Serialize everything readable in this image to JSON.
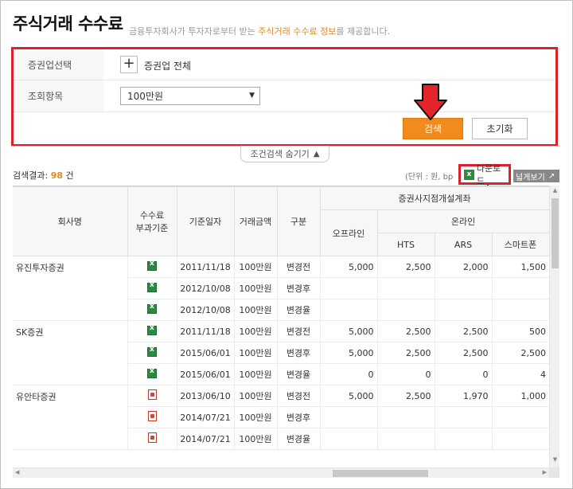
{
  "page": {
    "title": "주식거래 수수료",
    "subtitle_pre": "금융투자회사가 투자자로부터 받는 ",
    "subtitle_hl": "주식거래 수수료 정보",
    "subtitle_post": "를 제공합니다."
  },
  "search": {
    "company_label": "증권업선택",
    "company_plus": "+",
    "company_value": "증권업 전체",
    "item_label": "조회항목",
    "item_value": "100만원",
    "search_button": "검색",
    "reset_button": "초기화",
    "hide_toggle": "조건검색 숨기기"
  },
  "results": {
    "count_label": "검색결과: ",
    "count": "98",
    "count_unit": " 건",
    "unit_text": "(단위 : 원, bp",
    "download": "다운로드",
    "wide_view": "넓게보기"
  },
  "table": {
    "headers": {
      "company": "회사명",
      "basis_line1": "수수료",
      "basis_line2": "부과기준",
      "date": "기준일자",
      "amount": "거래금액",
      "type": "구분",
      "group": "증권사지점개설계좌",
      "offline": "오프라인",
      "online": "온라인",
      "hts": "HTS",
      "ars": "ARS",
      "smartphone": "스마트폰"
    },
    "rows": [
      {
        "company": "유진투자증권",
        "icon": "excel",
        "date": "2011/11/18",
        "amount": "100만원",
        "type": "변경전",
        "offline": "5,000",
        "hts": "2,500",
        "ars": "2,000",
        "smart": "1,500"
      },
      {
        "company": "",
        "icon": "excel",
        "date": "2012/10/08",
        "amount": "100만원",
        "type": "변경후",
        "offline": "",
        "hts": "",
        "ars": "",
        "smart": ""
      },
      {
        "company": "",
        "icon": "excel",
        "date": "2012/10/08",
        "amount": "100만원",
        "type": "변경율",
        "offline": "",
        "hts": "",
        "ars": "",
        "smart": ""
      },
      {
        "company": "SK증권",
        "icon": "excel",
        "date": "2011/11/18",
        "amount": "100만원",
        "type": "변경전",
        "offline": "5,000",
        "hts": "2,500",
        "ars": "2,500",
        "smart": "500"
      },
      {
        "company": "",
        "icon": "excel",
        "date": "2015/06/01",
        "amount": "100만원",
        "type": "변경후",
        "offline": "5,000",
        "hts": "2,500",
        "ars": "2,500",
        "smart": "2,500"
      },
      {
        "company": "",
        "icon": "excel",
        "date": "2015/06/01",
        "amount": "100만원",
        "type": "변경율",
        "offline": "0",
        "hts": "0",
        "ars": "0",
        "smart": "4"
      },
      {
        "company": "유안타증권",
        "icon": "pdf",
        "date": "2013/06/10",
        "amount": "100만원",
        "type": "변경전",
        "offline": "5,000",
        "hts": "2,500",
        "ars": "1,970",
        "smart": "1,000"
      },
      {
        "company": "",
        "icon": "pdf",
        "date": "2014/07/21",
        "amount": "100만원",
        "type": "변경후",
        "offline": "",
        "hts": "",
        "ars": "",
        "smart": ""
      },
      {
        "company": "",
        "icon": "pdf",
        "date": "2014/07/21",
        "amount": "100만원",
        "type": "변경율",
        "offline": "",
        "hts": "",
        "ars": "",
        "smart": ""
      }
    ]
  },
  "colors": {
    "accent_orange": "#f28b1e",
    "highlight_red": "#d8232a"
  }
}
